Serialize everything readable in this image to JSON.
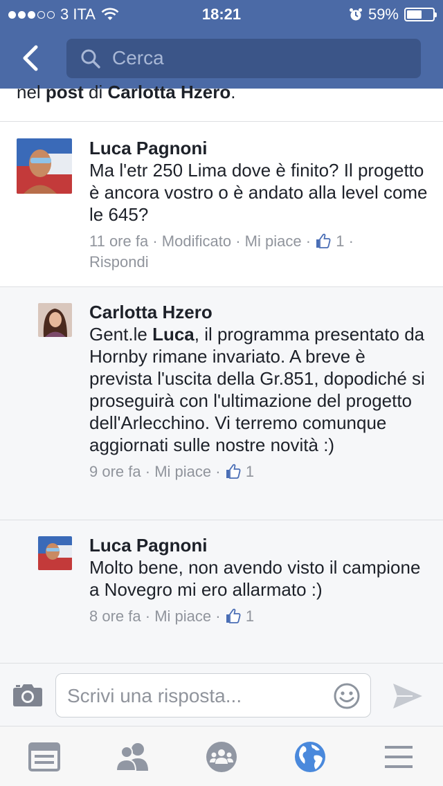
{
  "status_bar": {
    "carrier": "3 ITA",
    "time": "18:21",
    "battery_percent": "59%",
    "battery_level": 0.59,
    "signal_bars_filled": 3,
    "signal_bars_total": 5
  },
  "header": {
    "back_icon": "chevron-left-icon",
    "search_placeholder": "Cerca"
  },
  "truncated_intro": {
    "prefix": "nel ",
    "bold1": "post",
    "middle": " di ",
    "bold2": "Carlotta Hzero",
    "suffix": "."
  },
  "comments": [
    {
      "author": "Luca Pagnoni",
      "text": "Ma l'etr 250 Lima dove è finito? Il progetto è ancora vostro o è andato alla level come le 645?",
      "time": "11 ore fa",
      "edited": "Modificato",
      "like_label": "Mi piace",
      "like_count": "1",
      "reply_label": "Rispondi"
    },
    {
      "author": "Carlotta Hzero",
      "text_prefix": "Gent.le ",
      "text_bold": "Luca",
      "text_suffix": ", il programma presentato da Hornby rimane invariato. A breve è prevista l'uscita della Gr.851, dopodiché si proseguirà con l'ultimazione del progetto dell'Arlecchino. Vi terremo comunque aggiornati sulle nostre novità :)",
      "time": "9 ore fa",
      "like_label": "Mi piace",
      "like_count": "1"
    },
    {
      "author": "Luca Pagnoni",
      "text": "Molto bene, non avendo visto il campione a Novegro mi ero allarmato :)",
      "time": "8 ore fa",
      "like_label": "Mi piace",
      "like_count": "1"
    }
  ],
  "meta_separator": "·",
  "composer": {
    "placeholder": "Scrivi una risposta...",
    "camera_icon": "camera-icon",
    "emoji_icon": "smiley-icon",
    "send_icon": "send-icon"
  },
  "tabs": [
    "news-feed-icon",
    "friends-icon",
    "groups-icon",
    "globe-icon",
    "menu-icon"
  ],
  "colors": {
    "brand_blue": "#4b6aa6",
    "search_bg": "#3b5588",
    "meta_gray": "#90949c",
    "reply_bg": "#f6f7f9",
    "active_tab": "#4a89dc"
  }
}
